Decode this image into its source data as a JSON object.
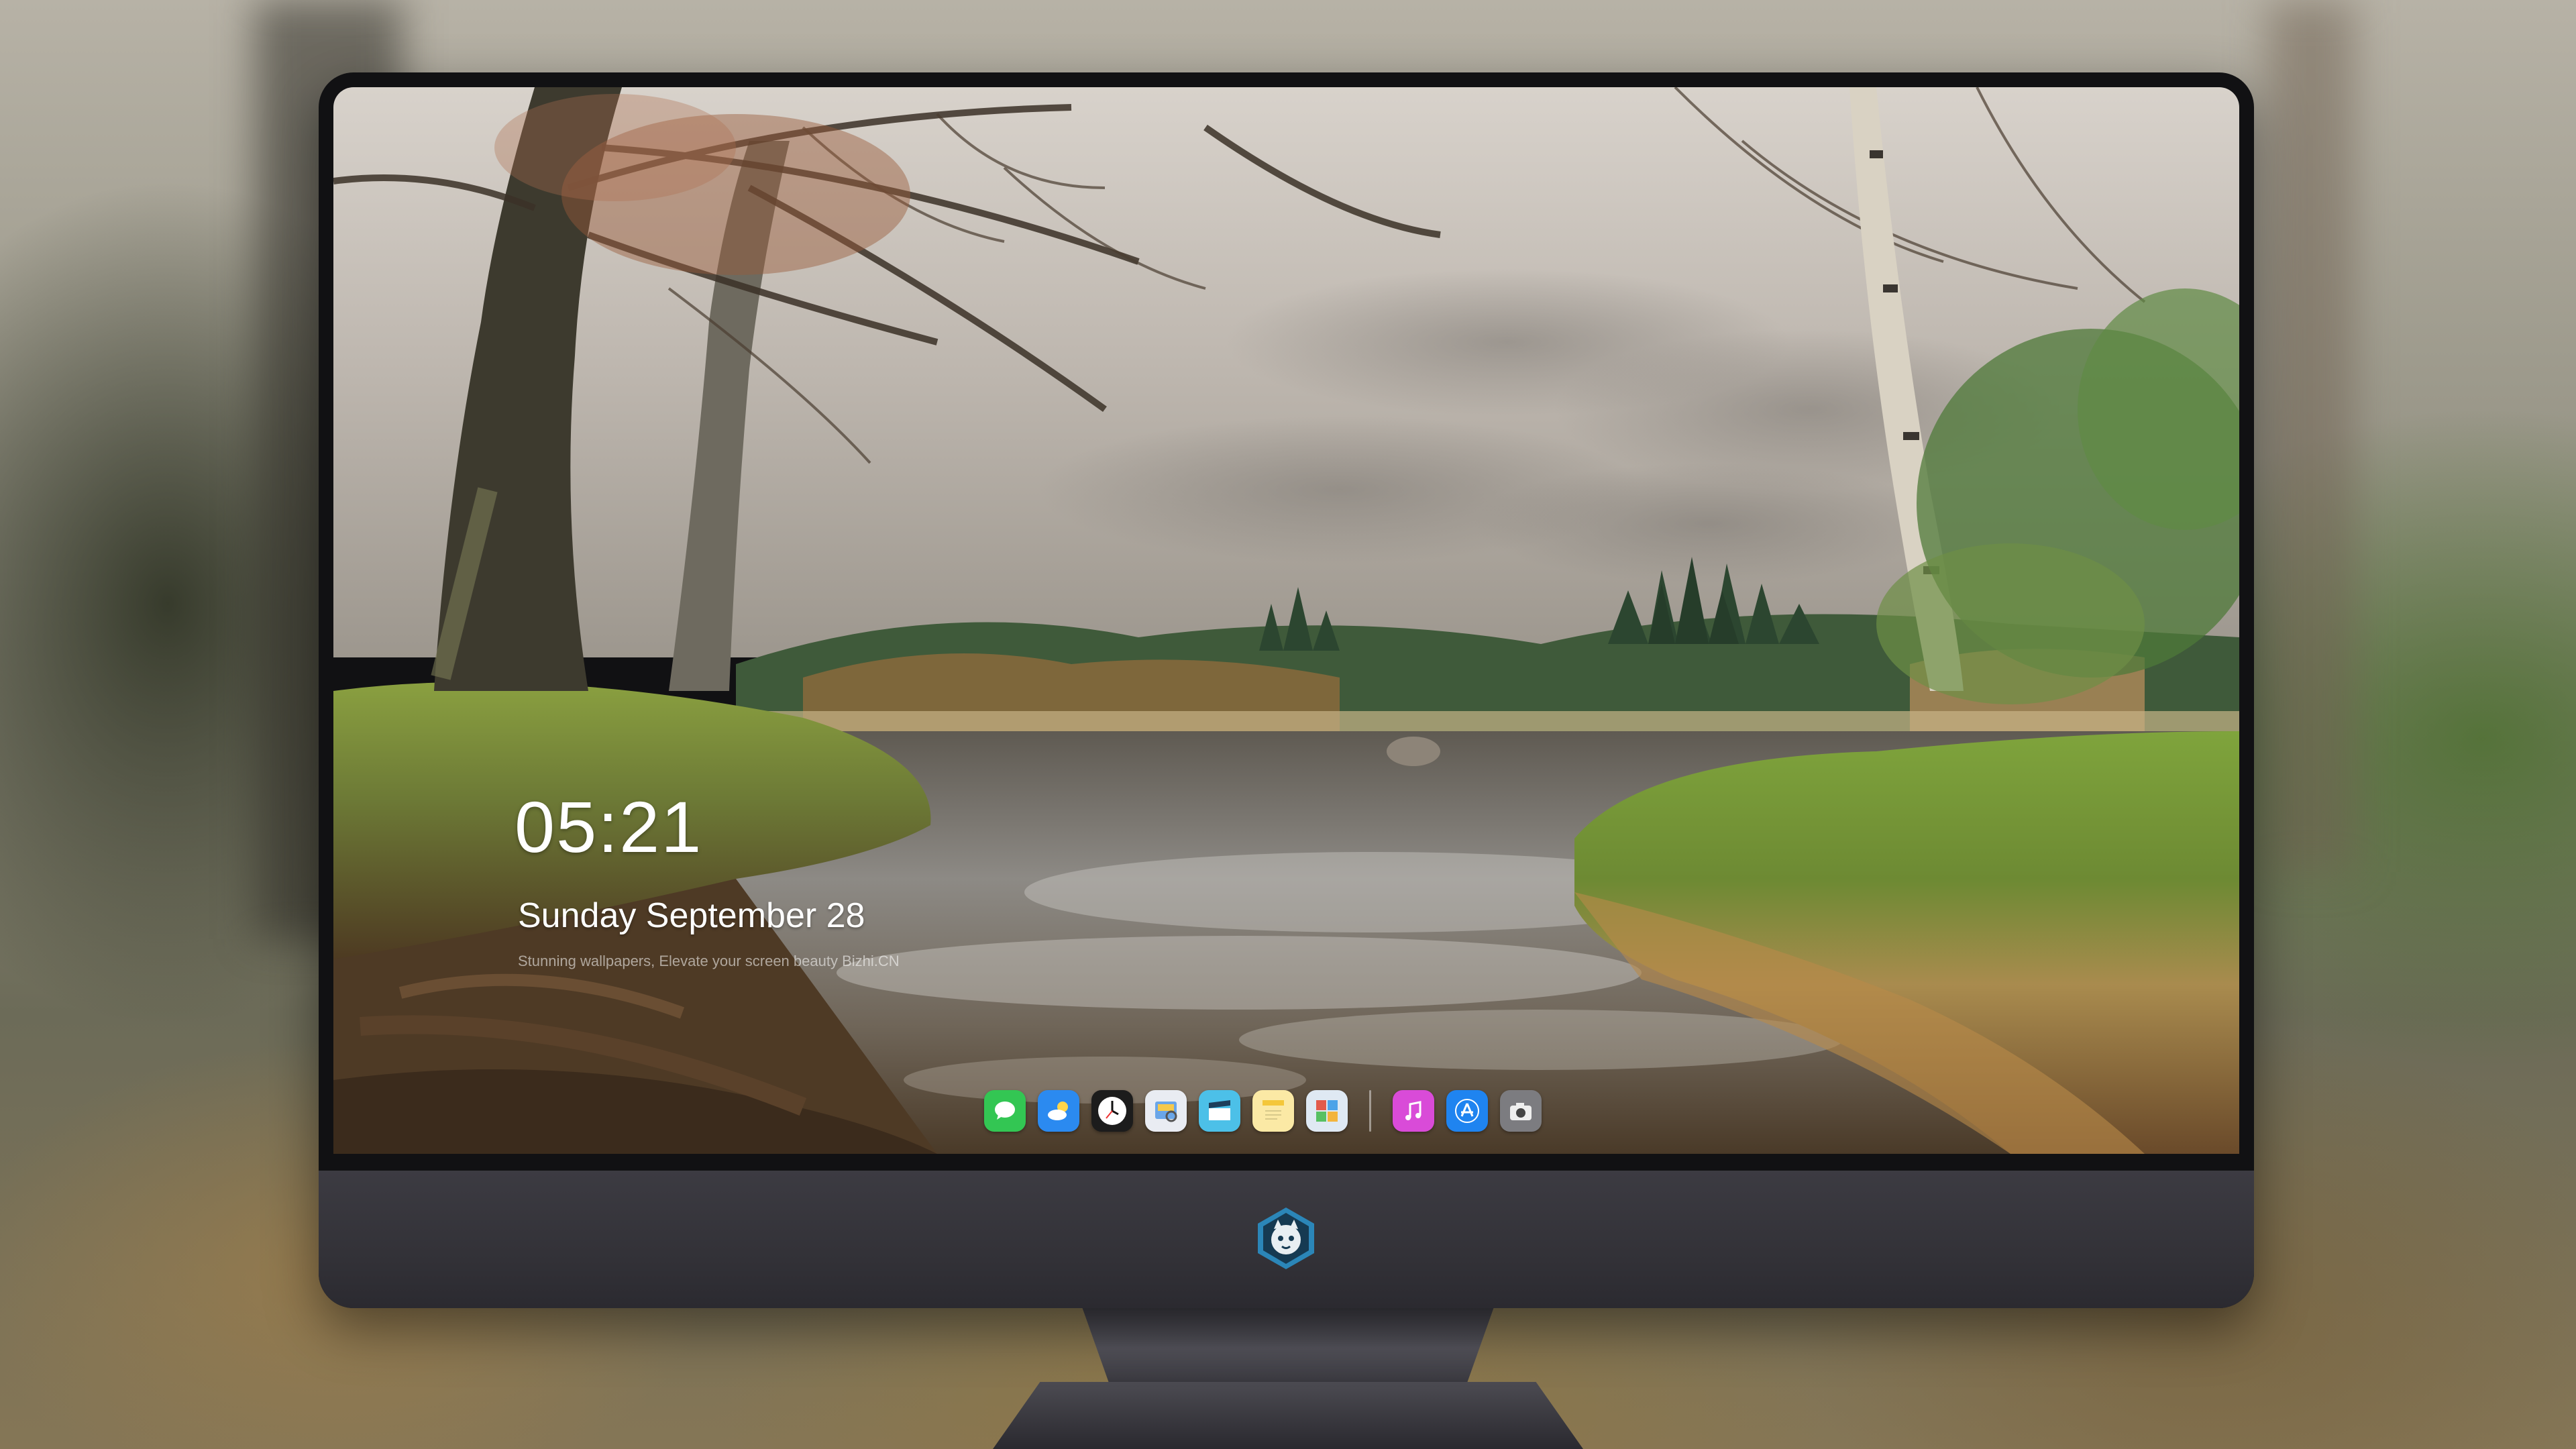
{
  "lockscreen": {
    "time": "05:21",
    "date": "Sunday September  28",
    "credit": "Stunning wallpapers, Elevate your screen beauty  Bizhi.CN"
  },
  "dock": {
    "apps": [
      {
        "name": "Messages",
        "icon": "speech-bubble-icon",
        "color": "#33c653"
      },
      {
        "name": "Weather",
        "icon": "cloud-sun-icon",
        "color": "#2b8af0"
      },
      {
        "name": "Clock",
        "icon": "clock-icon",
        "color": "#1c1c1c"
      },
      {
        "name": "Preview",
        "icon": "preview-icon",
        "color": "#e9ecf2"
      },
      {
        "name": "Clips",
        "icon": "clapperboard-icon",
        "color": "#4cc0e8"
      },
      {
        "name": "Notes",
        "icon": "notes-icon",
        "color": "#fbe9a5"
      },
      {
        "name": "Photo Booth",
        "icon": "photo-booth-icon",
        "color": "#dfe9f3"
      },
      {
        "name": "Music",
        "icon": "music-note-icon",
        "color": "#d94bd8"
      },
      {
        "name": "App Store",
        "icon": "app-store-icon",
        "color": "#1f84f0"
      },
      {
        "name": "Camera",
        "icon": "camera-icon",
        "color": "#7c7c80"
      }
    ]
  }
}
